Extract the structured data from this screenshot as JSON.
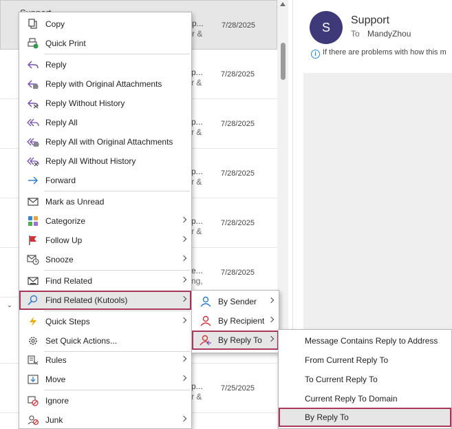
{
  "message_list": {
    "rows": [
      {
        "sender": "Support",
        "snip1": "p...",
        "snip2": "r &",
        "date": "7/28/2025",
        "selected": true
      },
      {
        "sender": "",
        "snip1": "p...",
        "snip2": "r &",
        "date": "7/28/2025"
      },
      {
        "sender": "",
        "snip1": "p...",
        "snip2": "r &",
        "date": "7/28/2025"
      },
      {
        "sender": "",
        "snip1": "p...",
        "snip2": "r &",
        "date": "7/28/2025"
      },
      {
        "sender": "",
        "snip1": "p...",
        "snip2": "r &",
        "date": "7/28/2025"
      },
      {
        "sender": "",
        "snip1": "e...",
        "snip2": "ng,",
        "date": "7/28/2025"
      },
      {
        "sender": "",
        "snip1": "",
        "snip2": "",
        "date": ""
      },
      {
        "sender": "",
        "snip1": "p...",
        "snip2": "r &",
        "date": "7/25/2025"
      }
    ],
    "collapse_icon": "chevron-down-icon"
  },
  "reading_pane": {
    "avatar_letter": "S",
    "from_name": "Support",
    "to_label": "To",
    "to_name": "MandyZhou",
    "info_text": "If there are problems with how this m"
  },
  "context_menu": {
    "copy": "Copy",
    "quick_print": "Quick Print",
    "reply": "Reply",
    "reply_with_attachments": "Reply with Original Attachments",
    "reply_without_history": "Reply Without History",
    "reply_all": "Reply All",
    "reply_all_with_attachments": "Reply All with Original Attachments",
    "reply_all_without_history": "Reply All Without History",
    "forward": "Forward",
    "mark_unread": "Mark as Unread",
    "categorize": "Categorize",
    "follow_up": "Follow Up",
    "snooze": "Snooze",
    "find_related": "Find Related",
    "find_related_kutools": "Find Related (Kutools)",
    "quick_steps": "Quick Steps",
    "set_quick_actions": "Set Quick Actions...",
    "rules": "Rules",
    "move": "Move",
    "ignore": "Ignore",
    "junk": "Junk"
  },
  "submenu_kutools": {
    "by_sender": "By Sender",
    "by_recipient": "By Recipient",
    "by_reply_to": "By Reply To"
  },
  "submenu_reply_to": {
    "contains_address": "Message Contains Reply to Address",
    "from_current": "From Current Reply To",
    "to_current": "To Current Reply To",
    "current_domain": "Current Reply To Domain",
    "by_reply_to": "By Reply To"
  },
  "colors": {
    "accent_highlight": "#a8375a",
    "avatar_bg": "#3e3a7a",
    "info_blue": "#2b88d8"
  }
}
